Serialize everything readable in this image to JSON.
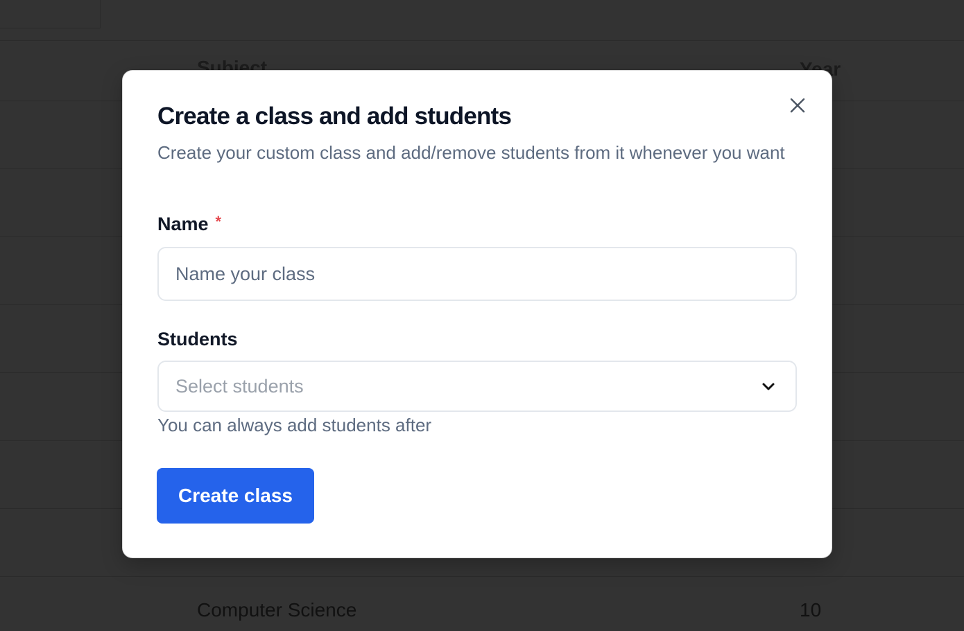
{
  "background": {
    "table_headers": {
      "subject": "Subject",
      "year": "Year"
    },
    "visible_row": {
      "subject": "Computer Science",
      "year": "10"
    }
  },
  "modal": {
    "title": "Create a class and add students",
    "description": "Create your custom class and add/remove students from it whenever you want",
    "close_icon": "close-icon",
    "name_field": {
      "label": "Name",
      "required_marker": "*",
      "placeholder": "Name your class",
      "value": ""
    },
    "students_field": {
      "label": "Students",
      "placeholder": "Select students",
      "helper_text": "You can always add students after",
      "icon": "chevron-down-icon"
    },
    "submit_label": "Create class"
  },
  "colors": {
    "overlay": "#333333",
    "primary": "#2563eb",
    "required": "#e5484d",
    "muted_text": "#5d6b80"
  }
}
